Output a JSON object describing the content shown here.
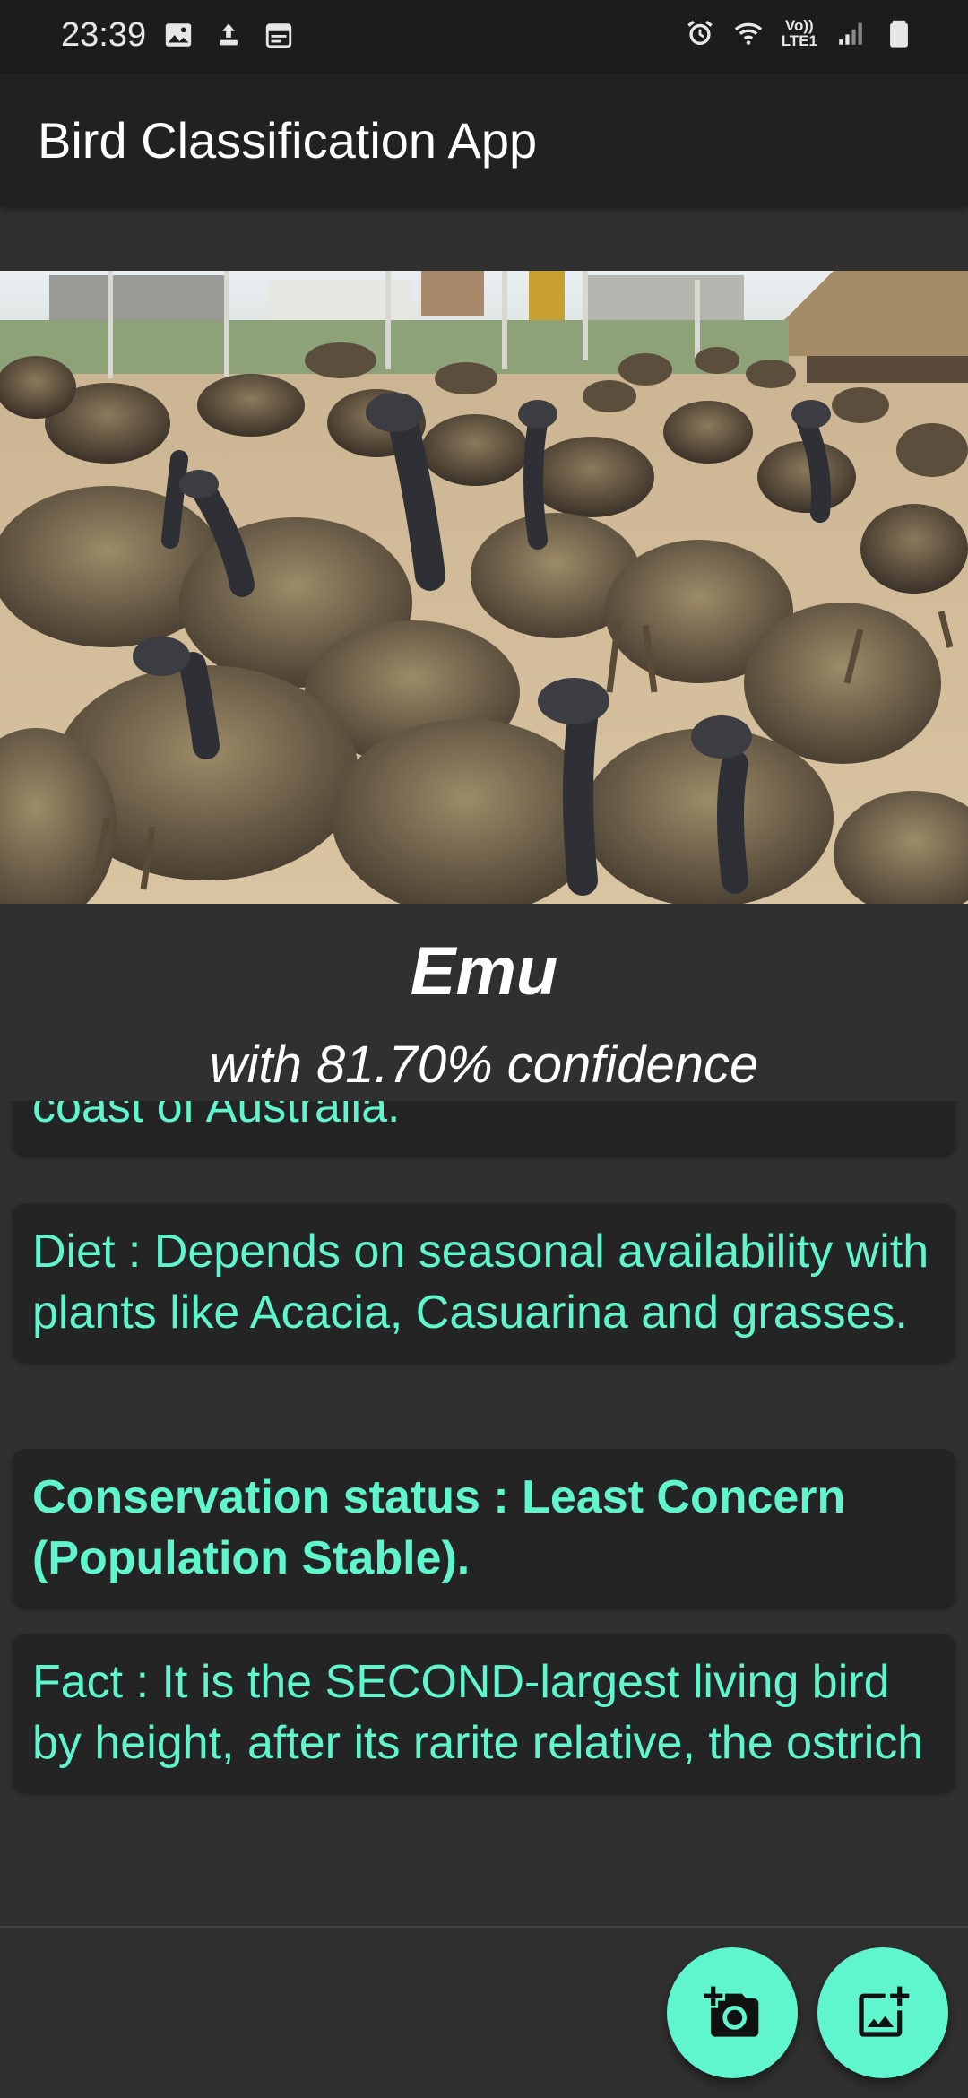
{
  "status_bar": {
    "time": "23:39",
    "left_icons": [
      "image-icon",
      "upload-icon",
      "calendar-icon"
    ],
    "right_icons": [
      "alarm-icon",
      "wifi-icon",
      "volte-icon",
      "signal-icon",
      "battery-icon"
    ],
    "volte_top": "Vo))",
    "volte_bottom": "LTE1"
  },
  "app_bar": {
    "title": "Bird Classification App"
  },
  "result": {
    "name": "Emu",
    "confidence": "with 81.70% confidence"
  },
  "cards": [
    {
      "text": "coast of Australia."
    },
    {
      "text": "Diet : Depends on seasonal availability with plants like Acacia, Casuarina and grasses."
    },
    {
      "text": "Conservation status : Least Concern (Population Stable)."
    },
    {
      "text": "Fact : It is the SECOND-largest living bird by height, after its rarite relative, the ostrich"
    }
  ],
  "fabs": {
    "camera": "add-a-photo-icon",
    "gallery": "add-photo-alternate-icon"
  },
  "colors": {
    "accent": "#5ff5cd",
    "background": "#303030",
    "app_bar": "#212121",
    "card": "#242424"
  }
}
